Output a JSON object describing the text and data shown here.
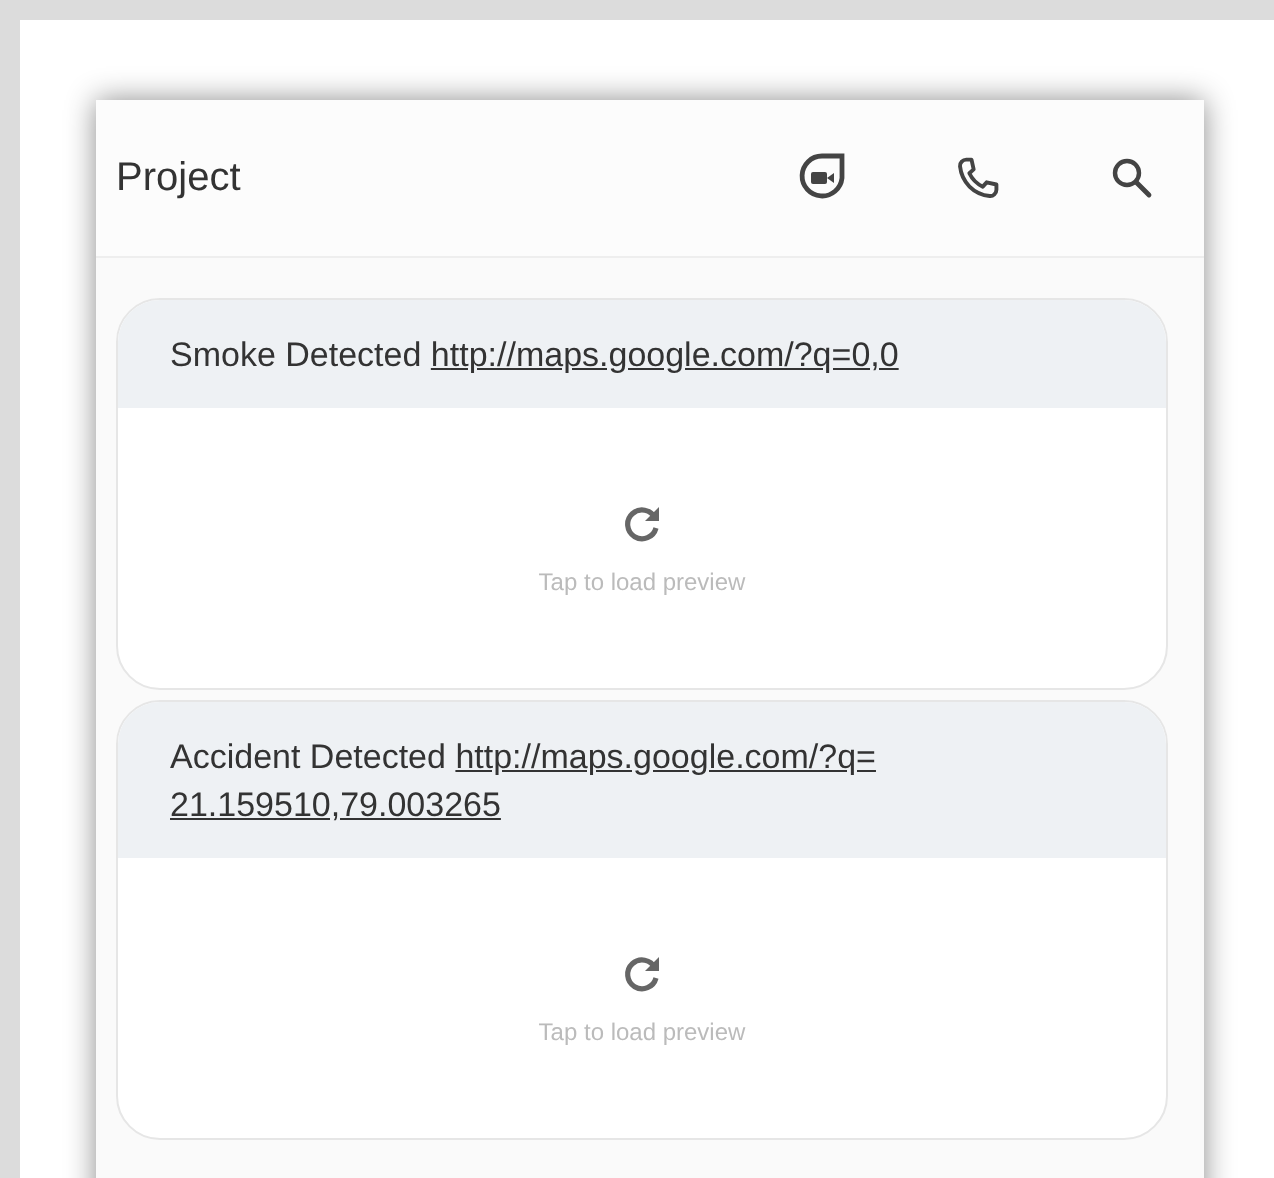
{
  "header": {
    "title": "Project"
  },
  "messages": [
    {
      "text": "Smoke Detected",
      "link_lines": [
        "http://maps.google.com/?q=0,0"
      ],
      "preview": "Tap to load preview"
    },
    {
      "text": "Accident Detected",
      "link_lines": [
        "http://maps.google.com/?q=",
        "21.159510,79.003265"
      ],
      "preview": "Tap to load preview"
    }
  ]
}
